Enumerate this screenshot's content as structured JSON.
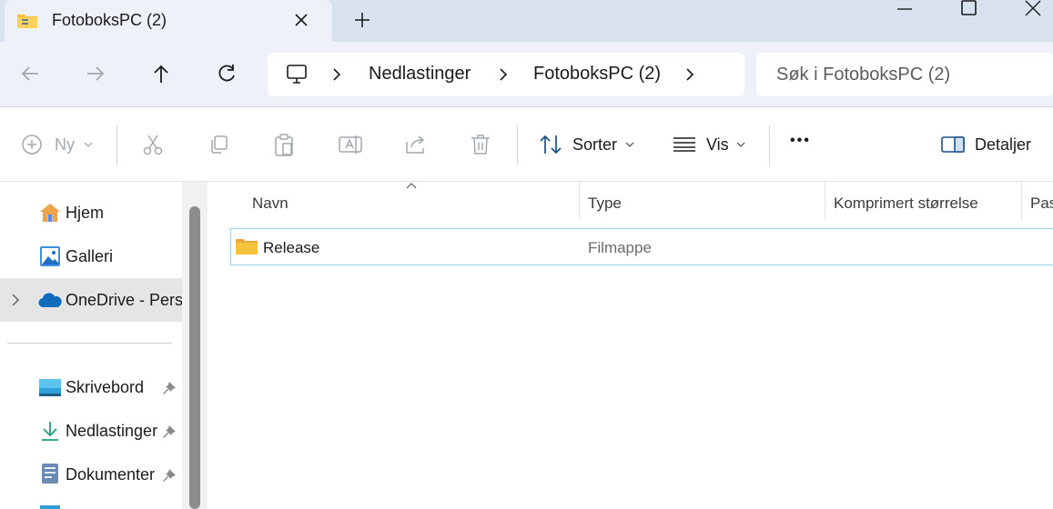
{
  "window": {
    "tab_title": "FotoboksPC (2)",
    "tab_icon": "folder-zip-icon",
    "new_tab_label": "+"
  },
  "address": {
    "breadcrumbs": [
      "Nedlastinger",
      "FotoboksPC (2)"
    ],
    "search_placeholder": "Søk i FotoboksPC (2)"
  },
  "toolbar": {
    "new_label": "Ny",
    "sort_label": "Sorter",
    "view_label": "Vis",
    "more_label": "•••",
    "details_label": "Detaljer"
  },
  "sidebar": {
    "items": [
      {
        "label": "Hjem",
        "icon": "home-icon"
      },
      {
        "label": "Galleri",
        "icon": "gallery-icon"
      },
      {
        "label": "OneDrive - Perso",
        "icon": "onedrive-cloud-icon"
      },
      {
        "label": "Skrivebord",
        "icon": "desktop-icon",
        "pinned": true
      },
      {
        "label": "Nedlastinger",
        "icon": "download-icon",
        "pinned": true
      },
      {
        "label": "Dokumenter",
        "icon": "documents-icon",
        "pinned": true
      }
    ]
  },
  "columns": [
    "Navn",
    "Type",
    "Komprimert størrelse",
    "Pas"
  ],
  "files": [
    {
      "name": "Release",
      "type": "Filmappe",
      "icon": "folder-icon"
    }
  ],
  "colors": {
    "title_bar": "#d9e2ef",
    "address_bar": "#eef2f8",
    "selection_border": "#99d1e8",
    "onedrive_blue": "#0f6cbd",
    "folder_yellow": "#f5c33b"
  }
}
